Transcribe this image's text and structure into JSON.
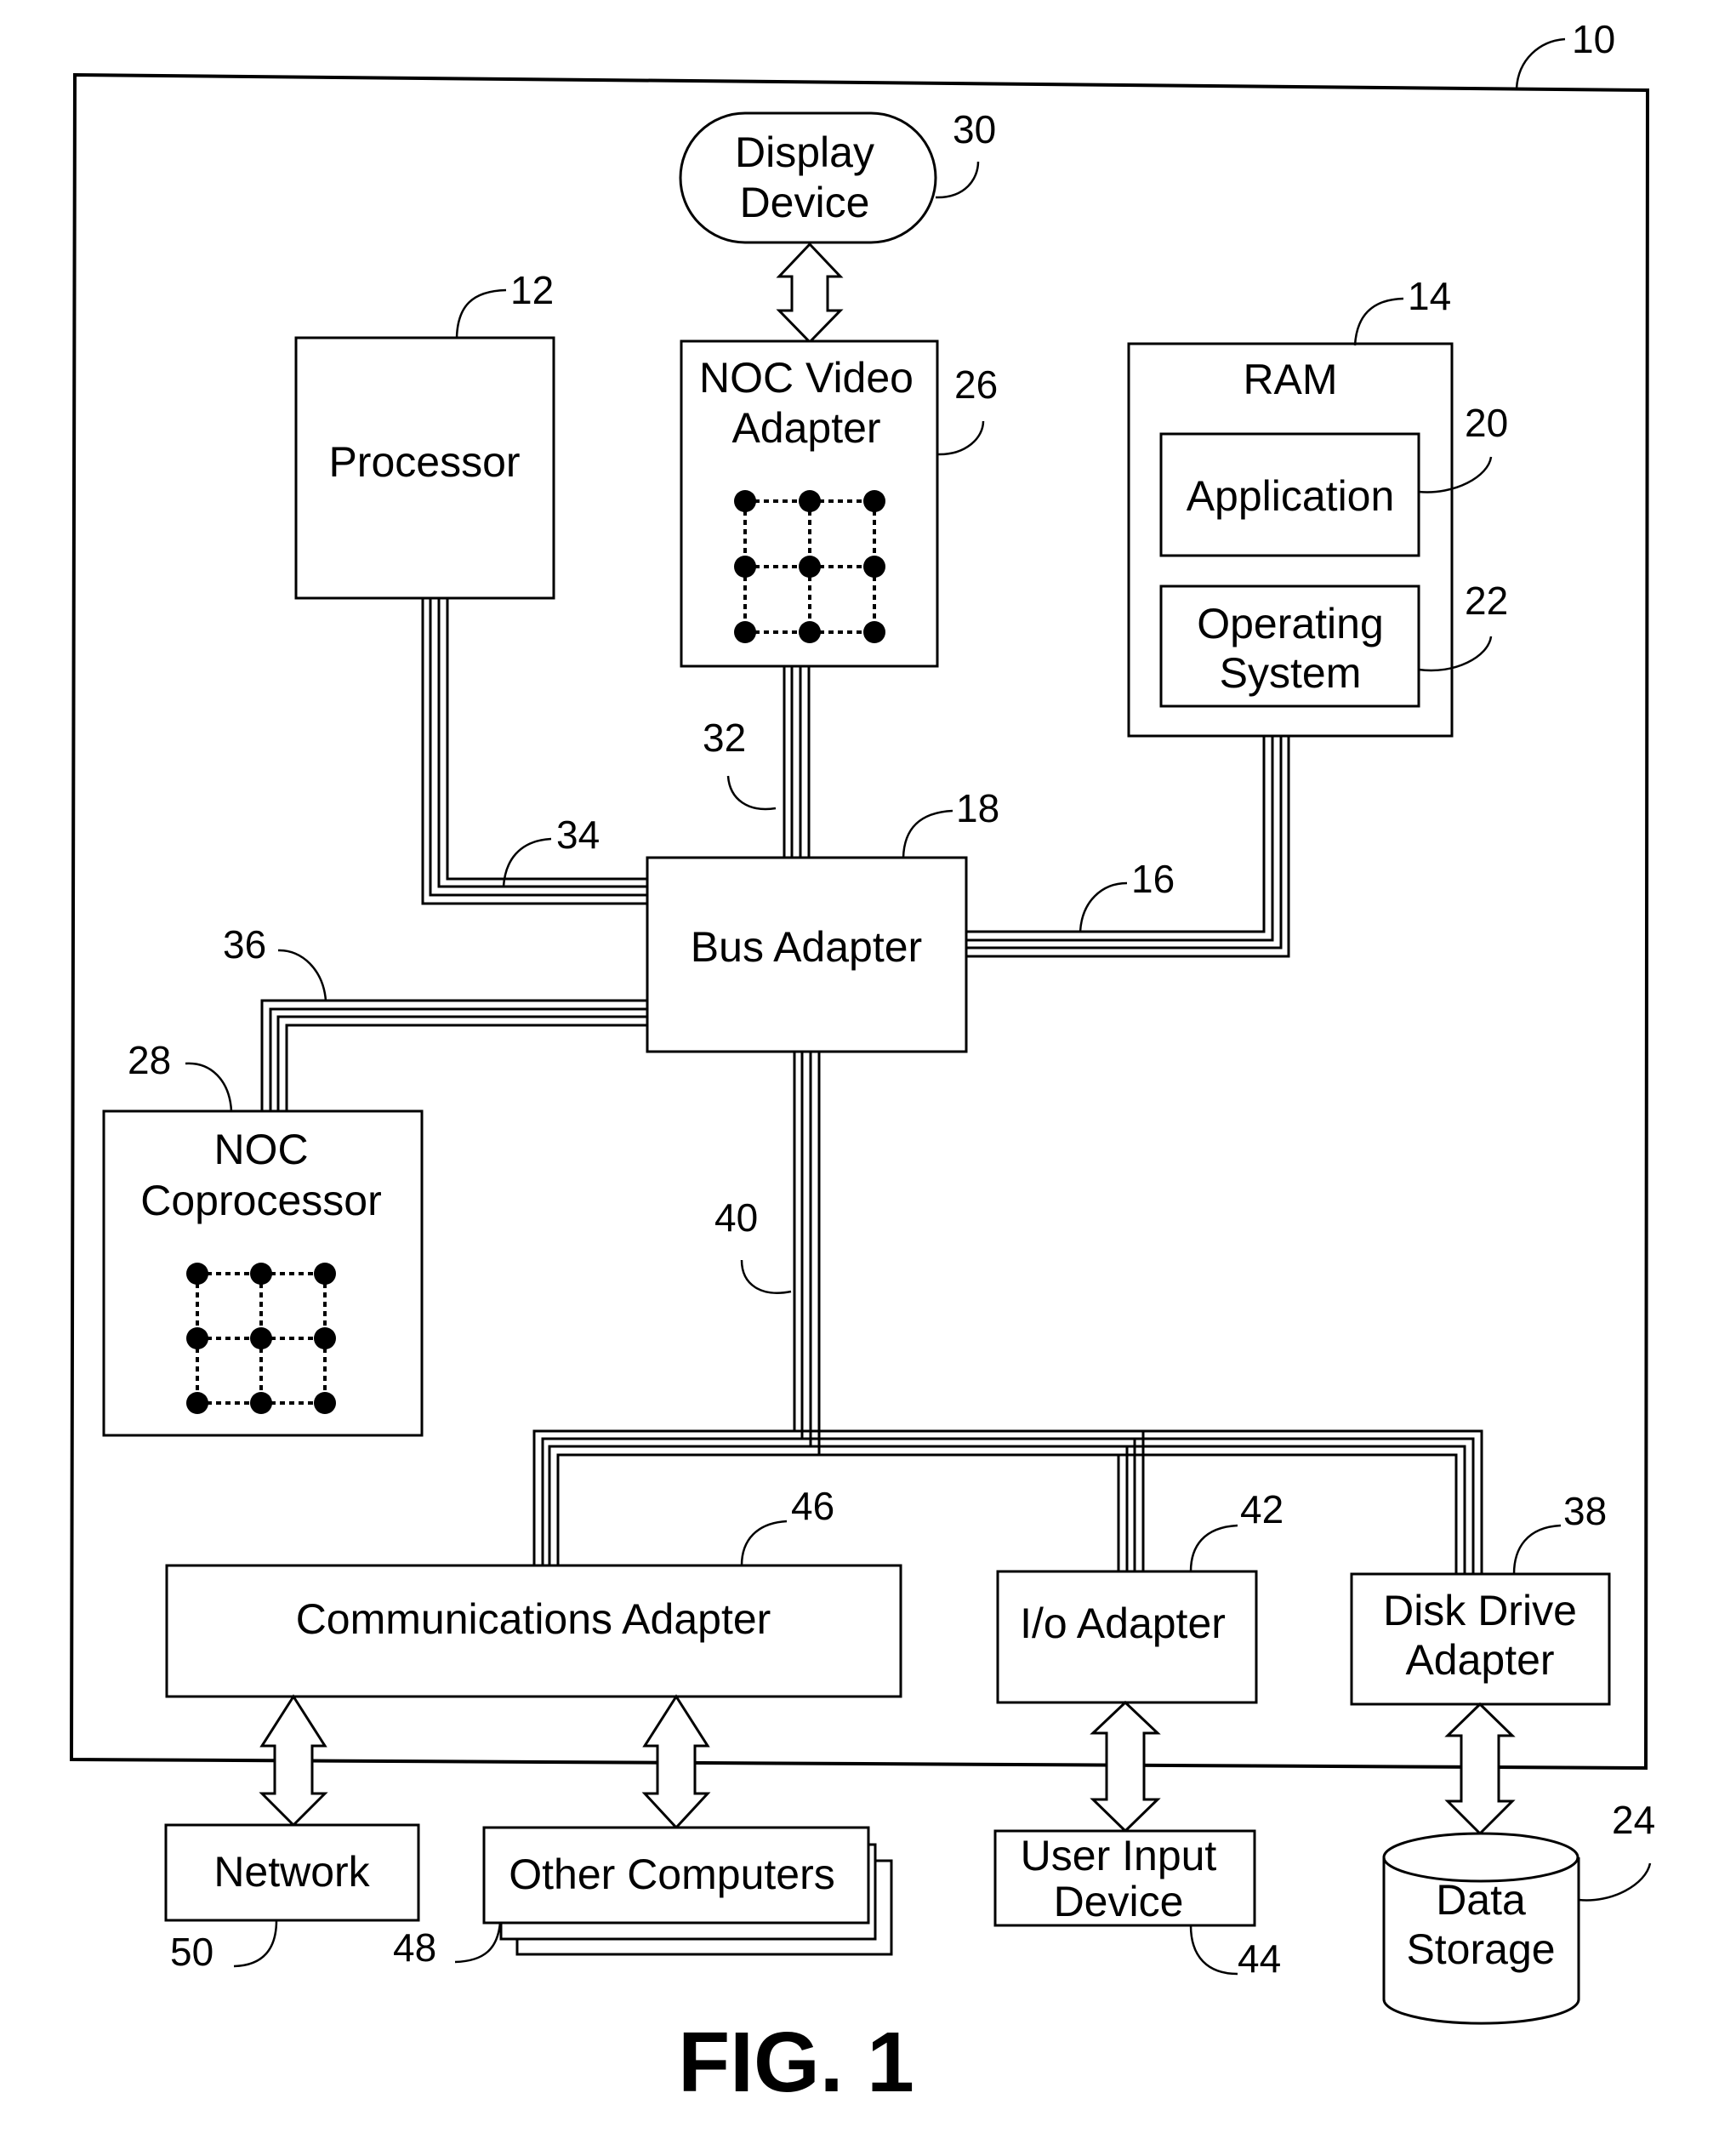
{
  "figure": {
    "caption": "FIG. 1",
    "system_ref": "10"
  },
  "components": {
    "display_device": {
      "lines": [
        "Display",
        "Device"
      ],
      "ref": "30"
    },
    "processor": {
      "lines": [
        "Processor"
      ],
      "ref": "12"
    },
    "noc_video_adapter": {
      "lines": [
        "NOC Video",
        "Adapter"
      ],
      "ref": "26"
    },
    "ram": {
      "lines": [
        "RAM"
      ],
      "ref": "14"
    },
    "application": {
      "lines": [
        "Application"
      ],
      "ref": "20"
    },
    "operating_system": {
      "lines": [
        "Operating",
        "System"
      ],
      "ref": "22"
    },
    "bus_adapter": {
      "lines": [
        "Bus Adapter"
      ],
      "ref": "18"
    },
    "noc_coprocessor": {
      "lines": [
        "NOC",
        "Coprocessor"
      ],
      "ref": "28"
    },
    "communications_adapter": {
      "lines": [
        "Communications Adapter"
      ],
      "ref": "46"
    },
    "io_adapter": {
      "lines": [
        "I/o Adapter"
      ],
      "ref": "42"
    },
    "disk_drive_adapter": {
      "lines": [
        "Disk Drive",
        "Adapter"
      ],
      "ref": "38"
    },
    "network": {
      "lines": [
        "Network"
      ],
      "ref": "50"
    },
    "other_computers": {
      "lines": [
        "Other Computers"
      ],
      "ref": "48"
    },
    "user_input_device": {
      "lines": [
        "User Input",
        "Device"
      ],
      "ref": "44"
    },
    "data_storage": {
      "lines": [
        "Data",
        "Storage"
      ],
      "ref": "24"
    }
  },
  "buses": {
    "front_side_bus": {
      "ref": "34"
    },
    "video_bus": {
      "ref": "32"
    },
    "memory_bus": {
      "ref": "16"
    },
    "coprocessor_bus": {
      "ref": "36"
    },
    "expansion_bus": {
      "ref": "40"
    }
  }
}
